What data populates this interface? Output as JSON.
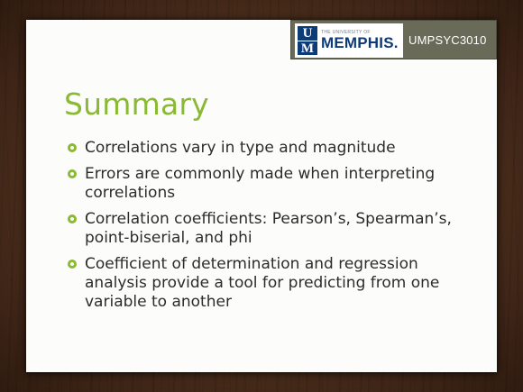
{
  "header": {
    "logo_small_text": "THE UNIVERSITY OF",
    "logo_big_text": "MEMPHIS.",
    "logo_letter_top": "U",
    "logo_letter_bottom": "M",
    "course_code": "UMPSYC3010"
  },
  "slide": {
    "title": "Summary",
    "bullets": [
      "Correlations vary in type and magnitude",
      "Errors are commonly made when interpreting correlations",
      "Correlation coefficients: Pearson’s, Spearman’s, point-biserial, and phi",
      "Coefficient of determination and regression analysis provide a tool for predicting from one variable to another"
    ]
  },
  "colors": {
    "accent_green": "#8ab933",
    "banner_gray": "#6a6a58",
    "memphis_blue": "#0d3b78",
    "background_wood": "#4a2d1c"
  },
  "icons": {
    "bullet": "ring-bullet-icon"
  }
}
